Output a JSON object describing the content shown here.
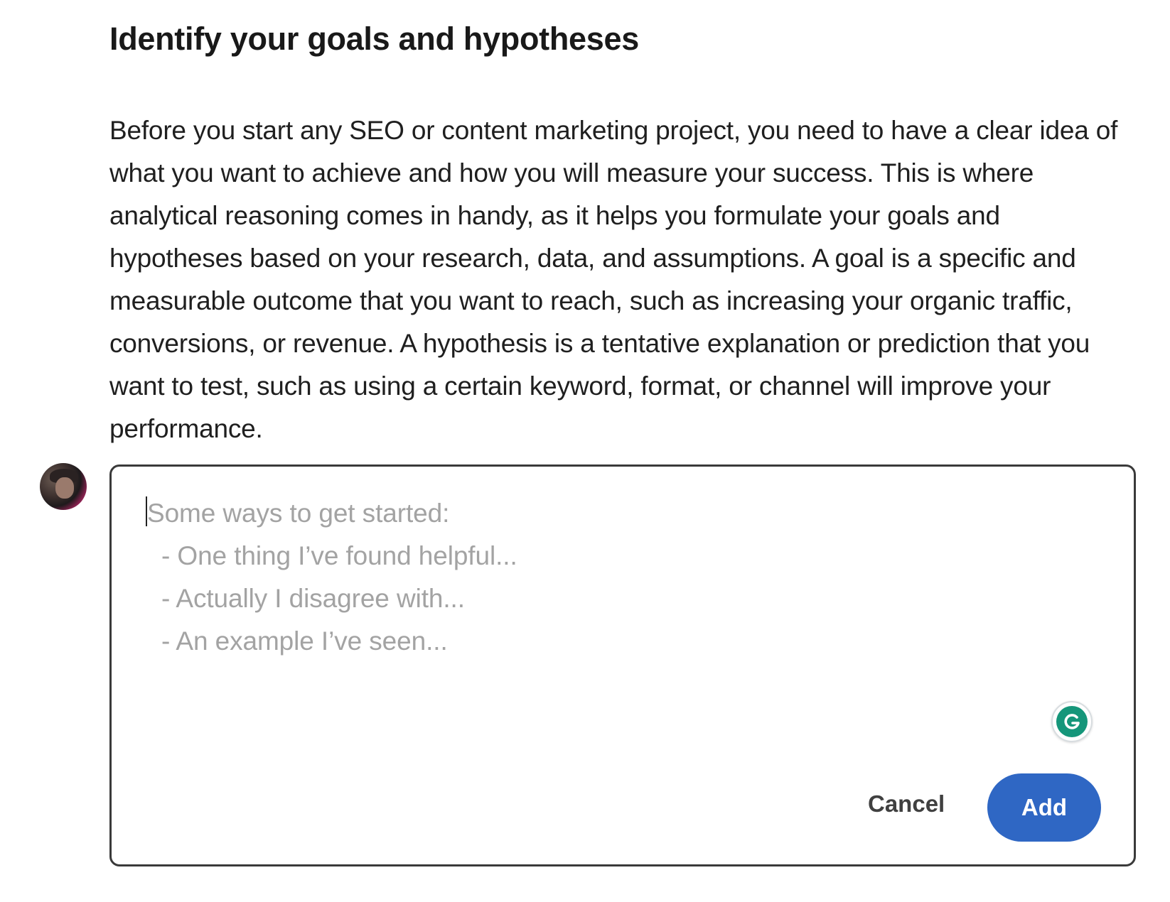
{
  "article": {
    "heading": "Identify your goals and hypotheses",
    "paragraph": "Before you start any SEO or content marketing project, you need to have a clear idea of what you want to achieve and how you will measure your success. This is where analytical reasoning comes in handy, as it helps you formulate your goals and hypotheses based on your research, data, and assumptions. A goal is a specific and measurable outcome that you want to reach, such as increasing your organic traffic, conversions, or revenue. A hypothesis is a tentative explanation or prediction that you want to test, such as using a certain keyword, format, or channel will improve your performance."
  },
  "composer": {
    "value": "",
    "placeholder_title": "Some ways to get started:",
    "placeholder_lines": [
      "- One thing I’ve found helpful...",
      "- Actually I disagree with...",
      "- An example I’ve seen..."
    ],
    "cancel_label": "Cancel",
    "add_label": "Add"
  },
  "icons": {
    "avatar": "user-avatar",
    "grammarly": "grammarly-icon"
  },
  "colors": {
    "add_button": "#2f67c4",
    "grammarly": "#15967a",
    "placeholder": "#a3a3a3"
  }
}
